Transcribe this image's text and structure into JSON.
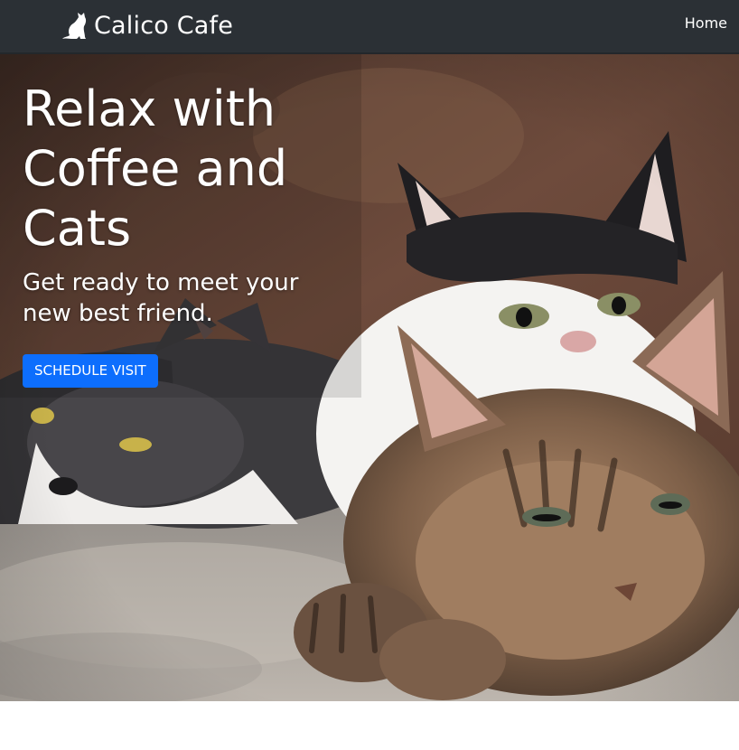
{
  "navbar": {
    "brand_text": "Calico Cafe",
    "brand_icon": "cat-silhouette-icon",
    "links": [
      {
        "label": "Home"
      }
    ]
  },
  "hero": {
    "title": "Relax with Coffee and Cats",
    "subtitle": "Get ready to meet your new best friend.",
    "cta_label": "SCHEDULE VISIT",
    "image": "hero-cats-photo"
  },
  "colors": {
    "navbar_bg": "#2b3035",
    "cta_bg": "#0d6efd",
    "text_light": "#ffffff"
  }
}
